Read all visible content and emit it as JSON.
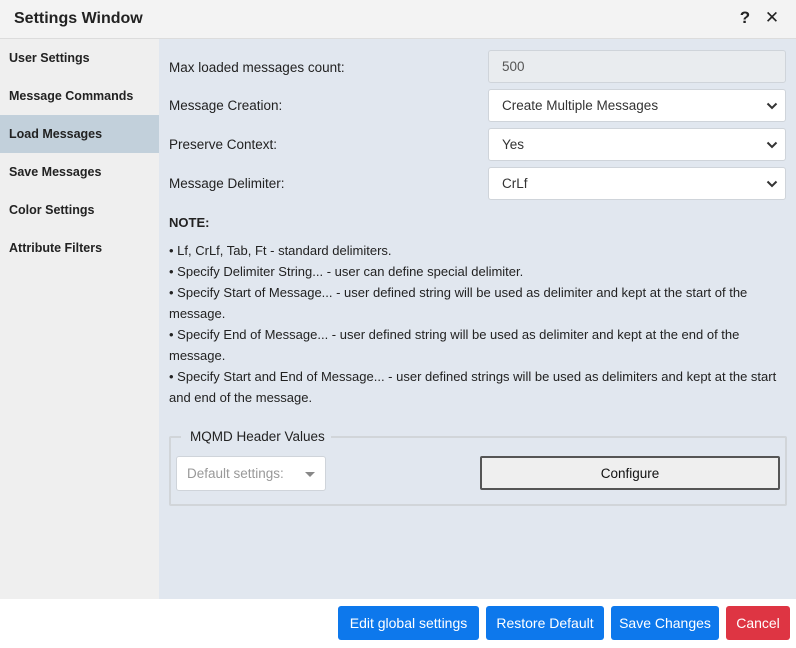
{
  "window": {
    "title": "Settings Window",
    "help_glyph": "?",
    "close_glyph": "✕"
  },
  "sidebar": {
    "items": [
      {
        "label": "User Settings",
        "active": false
      },
      {
        "label": "Message Commands",
        "active": false
      },
      {
        "label": "Load Messages",
        "active": true
      },
      {
        "label": "Save Messages",
        "active": false
      },
      {
        "label": "Color Settings",
        "active": false
      },
      {
        "label": "Attribute Filters",
        "active": false
      }
    ]
  },
  "form": {
    "max_loaded": {
      "label": "Max loaded messages count:",
      "value": "500"
    },
    "message_creation": {
      "label": "Message Creation:",
      "value": "Create Multiple Messages"
    },
    "preserve_context": {
      "label": "Preserve Context:",
      "value": "Yes"
    },
    "message_delimiter": {
      "label": "Message Delimiter:",
      "value": "CrLf"
    }
  },
  "note": {
    "title": "NOTE:",
    "lines": [
      "• Lf, CrLf, Tab, Ft - standard delimiters.",
      "• Specify Delimiter String... - user can define special delimiter.",
      "• Specify Start of Message... - user defined string will be used as delimiter and kept at the start of the message.",
      "• Specify End of Message... - user defined string will be used as delimiter and kept at the end of the message.",
      "• Specify Start and End of Message... - user defined strings will be used as delimiters and kept at the start and end of the message."
    ]
  },
  "mqmd": {
    "legend": "MQMD Header Values",
    "dropdown_placeholder": "Default settings:",
    "configure_label": "Configure"
  },
  "footer": {
    "edit_global": "Edit global settings",
    "restore_default": "Restore Default",
    "save_changes": "Save Changes",
    "cancel": "Cancel"
  },
  "colors": {
    "primary": "#0d78ec",
    "danger": "#de3543",
    "sidebar_active": "#c2d0db",
    "main_bg": "#e1e7ef"
  }
}
